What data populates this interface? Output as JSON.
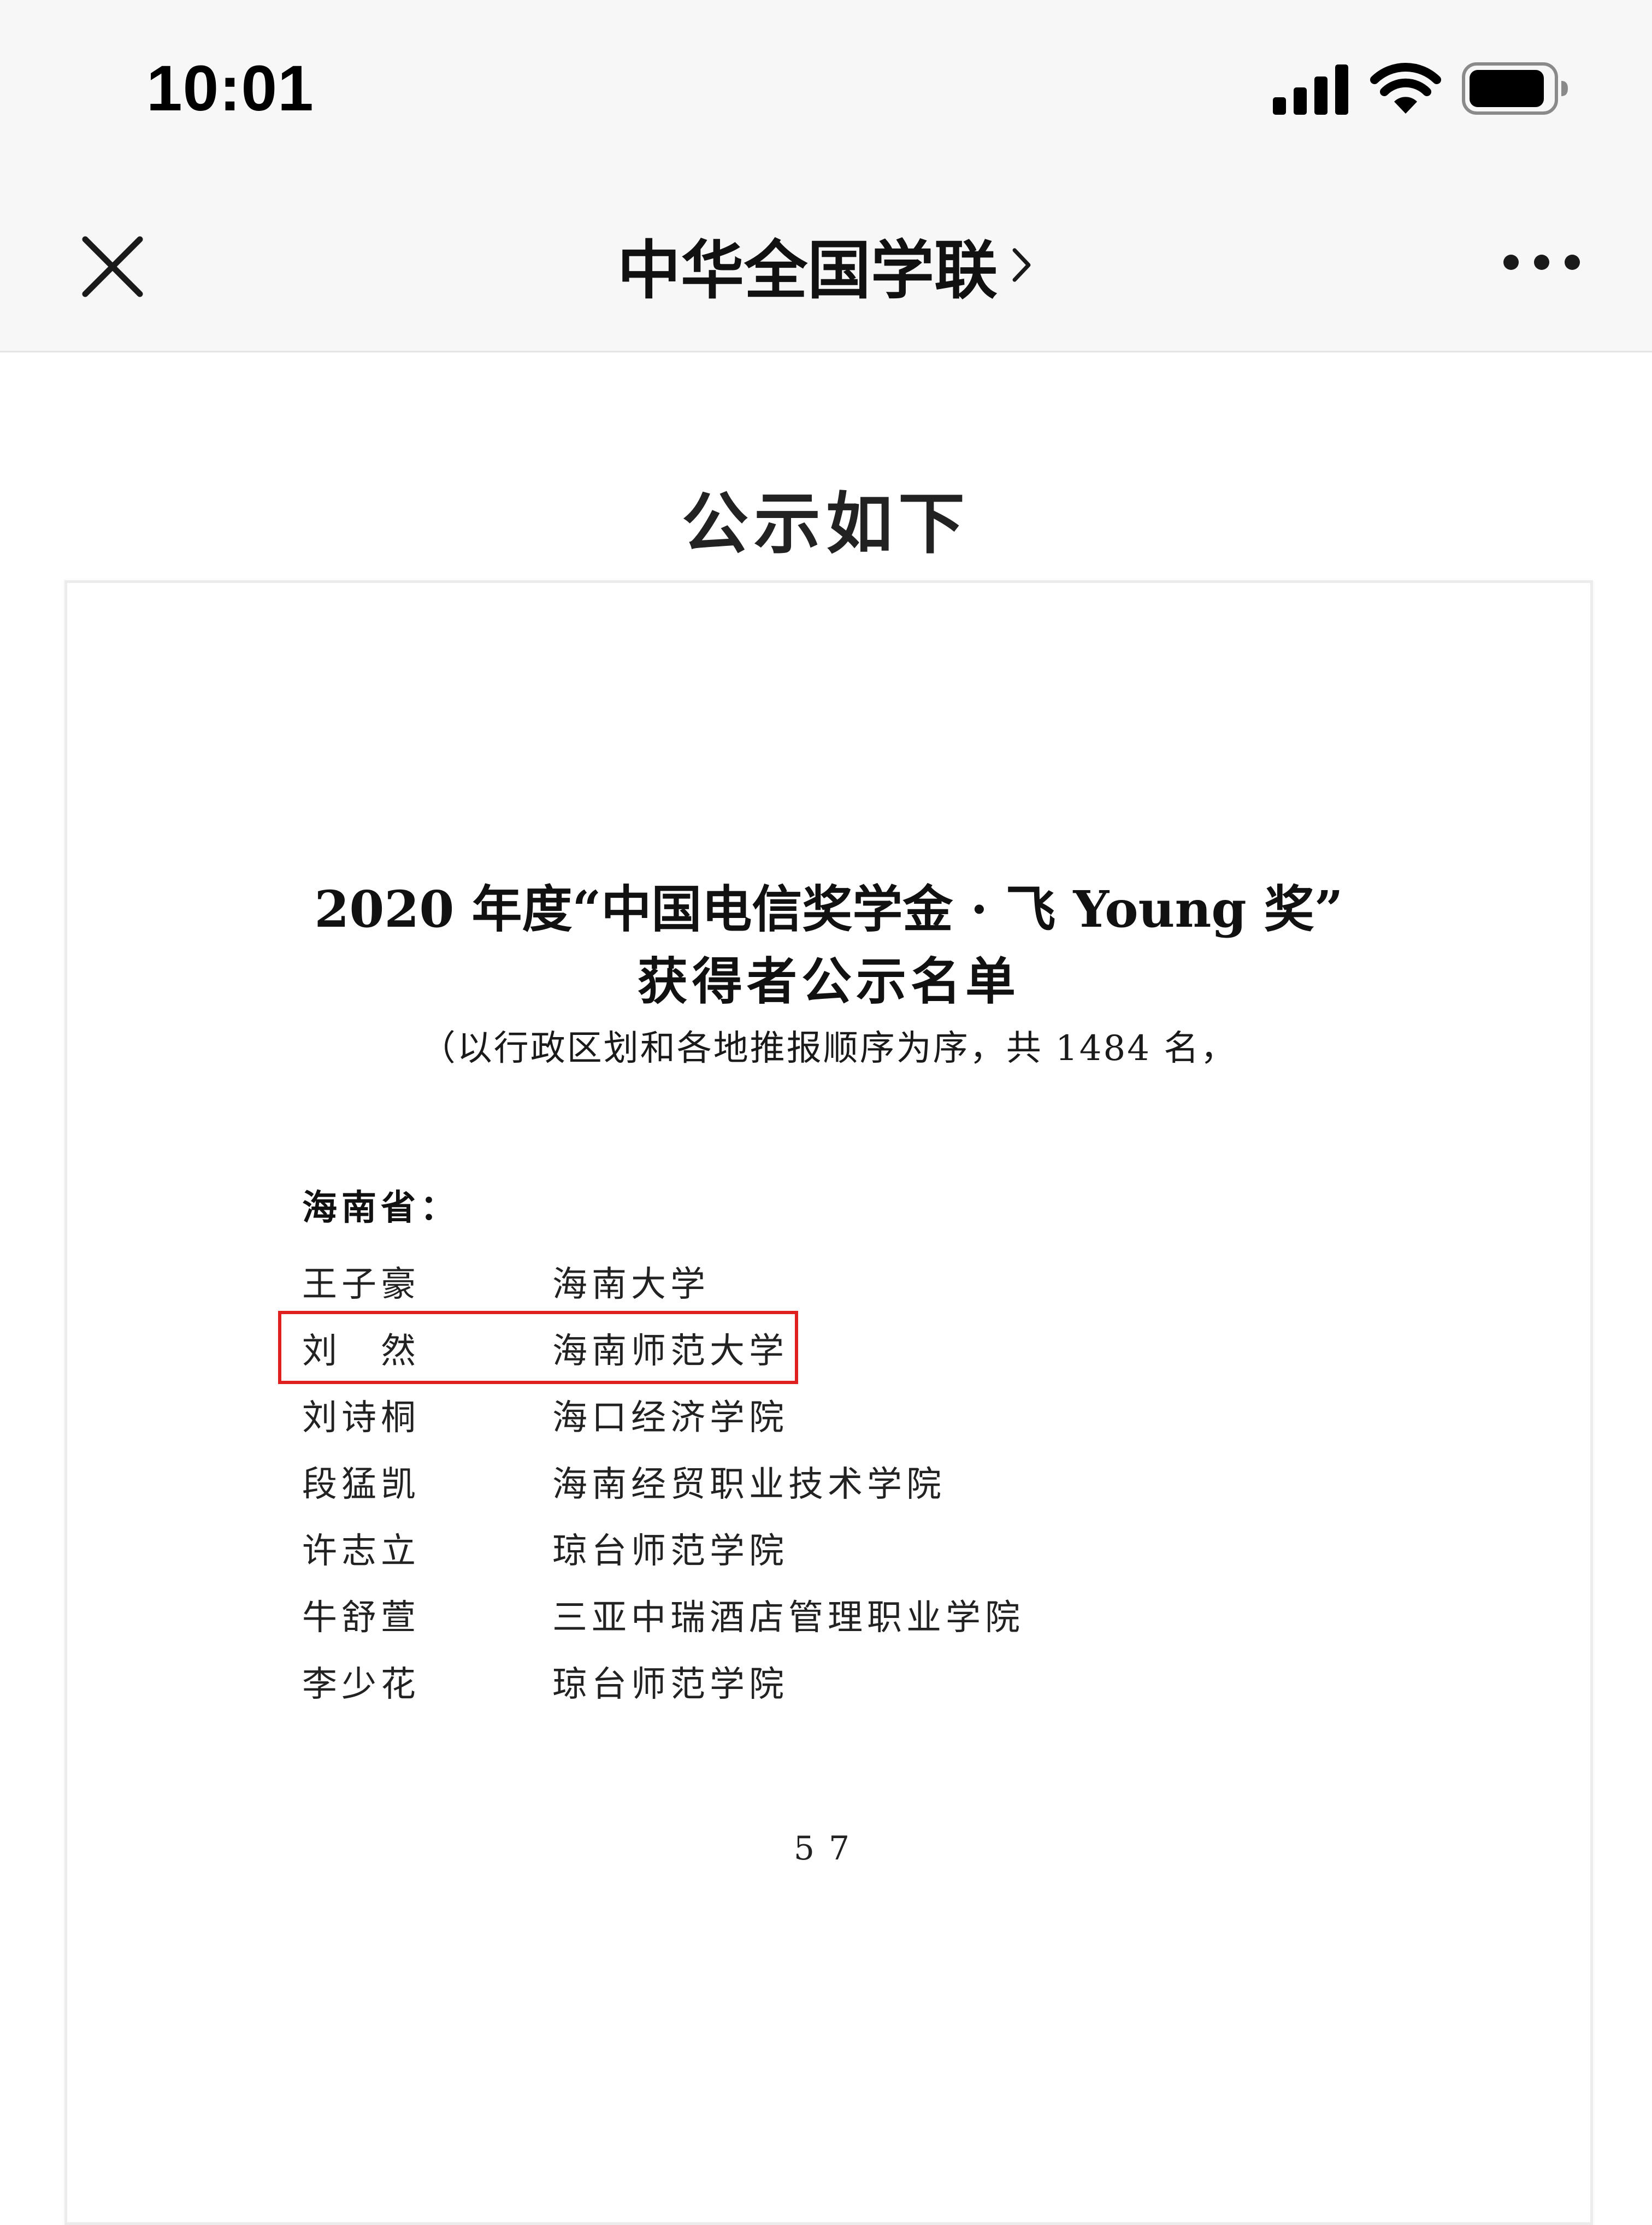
{
  "status_bar": {
    "time": "10:01"
  },
  "nav": {
    "title": "中华全国学联",
    "icons": [
      "close-icon",
      "chevron-right-icon",
      "more-icon"
    ]
  },
  "article": {
    "heading": "公示如下"
  },
  "document": {
    "title_line1": "2020 年度“中国电信奖学金 · 飞 Young 奖”",
    "title_line2": "获得者公示名单",
    "subtitle": "（以行政区划和各地推报顺序为序，共 1484 名，",
    "region": "海南省：",
    "recipients": [
      {
        "name": "王子豪",
        "school": "海南大学"
      },
      {
        "name": "刘　然",
        "school": "海南师范大学",
        "highlighted": true
      },
      {
        "name": "刘诗桐",
        "school": "海口经济学院"
      },
      {
        "name": "段猛凯",
        "school": "海南经贸职业技术学院"
      },
      {
        "name": "许志立",
        "school": "琼台师范学院"
      },
      {
        "name": "牛舒萱",
        "school": "三亚中瑞酒店管理职业学院"
      },
      {
        "name": "李少花",
        "school": "琼台师范学院"
      }
    ],
    "page_number": "57",
    "highlight_color": "#e0201e"
  }
}
